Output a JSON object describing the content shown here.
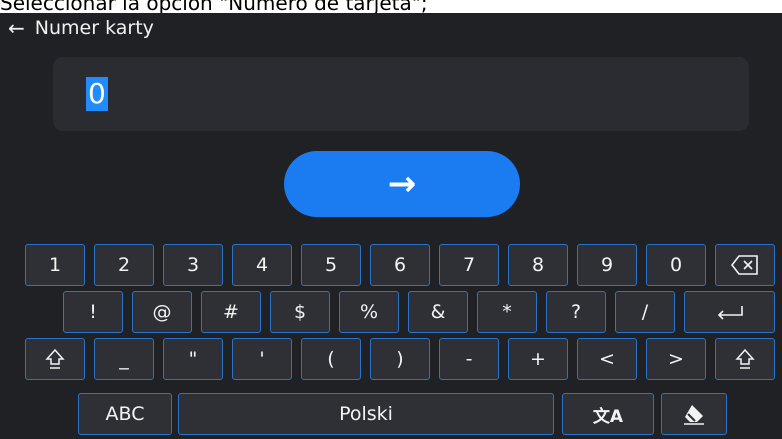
{
  "caption": "Seleccionar la opción \"Número de tarjeta\";",
  "header": {
    "title": "Numer karty",
    "back_icon": "←"
  },
  "field": {
    "value": "0"
  },
  "submit": {
    "icon": "→"
  },
  "keyboard": {
    "row1": [
      "1",
      "2",
      "3",
      "4",
      "5",
      "6",
      "7",
      "8",
      "9",
      "0"
    ],
    "row2": [
      "!",
      "@",
      "#",
      "$",
      "%",
      "&",
      "*",
      "?",
      "/"
    ],
    "row3": [
      "_",
      "\"",
      "'",
      "(",
      ")",
      "-",
      "+",
      "<",
      ">"
    ],
    "row4": {
      "abc": "ABC",
      "space": "Polski",
      "lang_icon": "文A"
    }
  },
  "colors": {
    "accent": "#1a7cf0",
    "key_border": "#2a74c9",
    "background": "#1f2125"
  }
}
